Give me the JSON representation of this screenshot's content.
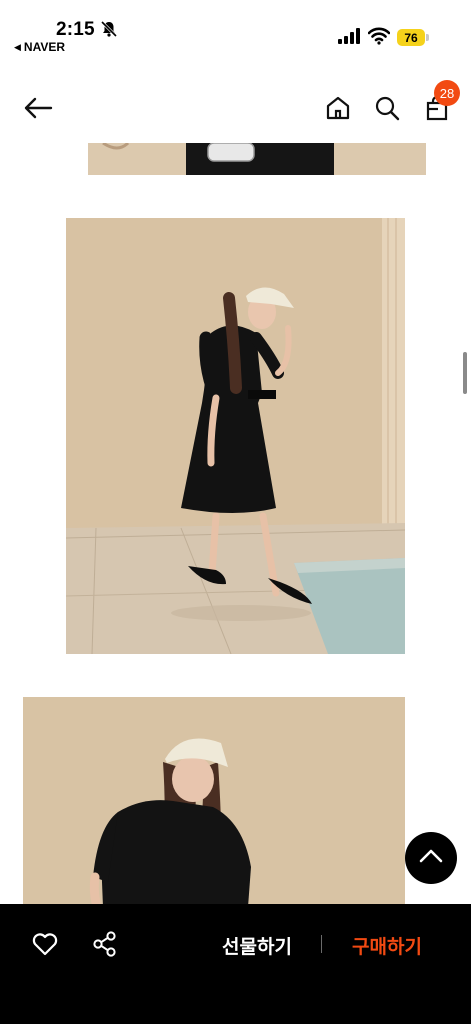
{
  "status_bar": {
    "time": "2:15",
    "back_app": "NAVER",
    "battery": "76",
    "icons": [
      "bell-off-icon",
      "signal-icon",
      "wifi-icon",
      "battery-icon"
    ]
  },
  "nav_bar": {
    "icons": [
      "back-arrow-icon",
      "home-icon",
      "search-icon",
      "shopping-bag-icon"
    ],
    "cart_count": "28",
    "badge_color": "#f24a12"
  },
  "content": {
    "photos": [
      "product-photo-top",
      "product-photo-main",
      "product-photo-bottom"
    ],
    "background_tones": [
      "#d9c4a6",
      "#c9b08c"
    ]
  },
  "floating": {
    "icon": "chevron-up-icon"
  },
  "bottom_bar": {
    "gift_label": "선물하기",
    "buy_label": "구매하기",
    "accent_color": "#f24a12",
    "icons": [
      "heart-icon",
      "share-icon"
    ]
  }
}
